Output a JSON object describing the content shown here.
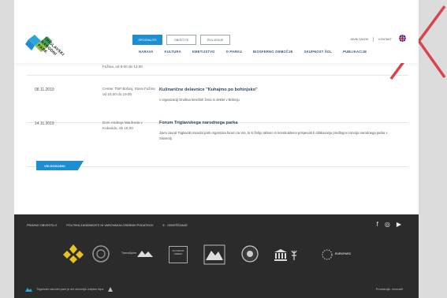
{
  "header": {
    "logo_lines": [
      "TRIGLAVSKI",
      "NARODNI",
      "PARK"
    ],
    "tabs": [
      "SPOZNAJTE",
      "OBIŠČITE",
      "ŽIVLJENJE"
    ],
    "nav": [
      "NARAVA",
      "KULTURA",
      "KMETIJSTVO",
      "O PARKU",
      "BIOSFERNO OBMOČJE",
      "SKUPNOST ŠOL",
      "PUBLIKACIJE"
    ],
    "util": [
      "JAVNI ZAVOD",
      "KONTAKT"
    ]
  },
  "events": [
    {
      "date": "",
      "place": "Fužina, od 9.00 do 13.00",
      "title": "",
      "desc": ""
    },
    {
      "date": "08.11.2019",
      "place": "Center TNP Bohinj, Stara Fužina od 15.00 do 19.00",
      "title": "Kulinarične delavnice \"Kuhajmo po bohinjsko\"",
      "desc": "v organizaciji Društva kmečkih žena in deklet v Bohinju"
    },
    {
      "date": "14.11.2019",
      "place": "Dom Andreja Manfreda v Kobaridu, ob 16.00",
      "title": "Forum Triglavskega narodnega parka",
      "desc": "Javni zavod Triglavski narodni park organizira forum za vse, ki si želijo aktivno in konstruktivno prispevati k oblikovanju predlogov razvoja narodnega parka v Sloveniji."
    }
  ],
  "all_events_label": "VSI DOGODKI",
  "footer": {
    "links": [
      "PRAVNO OBVESTILO",
      "POLITIKA ZASEBNOSTI IN VAROVANJA OSEBNIH PODATKOV",
      "E - OBVEŠČANJE"
    ],
    "social": [
      "f",
      "◎",
      "▶"
    ],
    "partner_transalpine": "TransAlpine",
    "partner_slovenia": "SLOVENIA GREEN",
    "partner_europarc": "EUROPARC",
    "bottom_text": "Triglavski narodni park je del območja Julijske Alpe",
    "credit": "Produkcija: Innovatif"
  },
  "colors": {
    "accent": "#1d8fd1",
    "footer_bg": "#2b2b2b",
    "cross": "#d9434e"
  }
}
